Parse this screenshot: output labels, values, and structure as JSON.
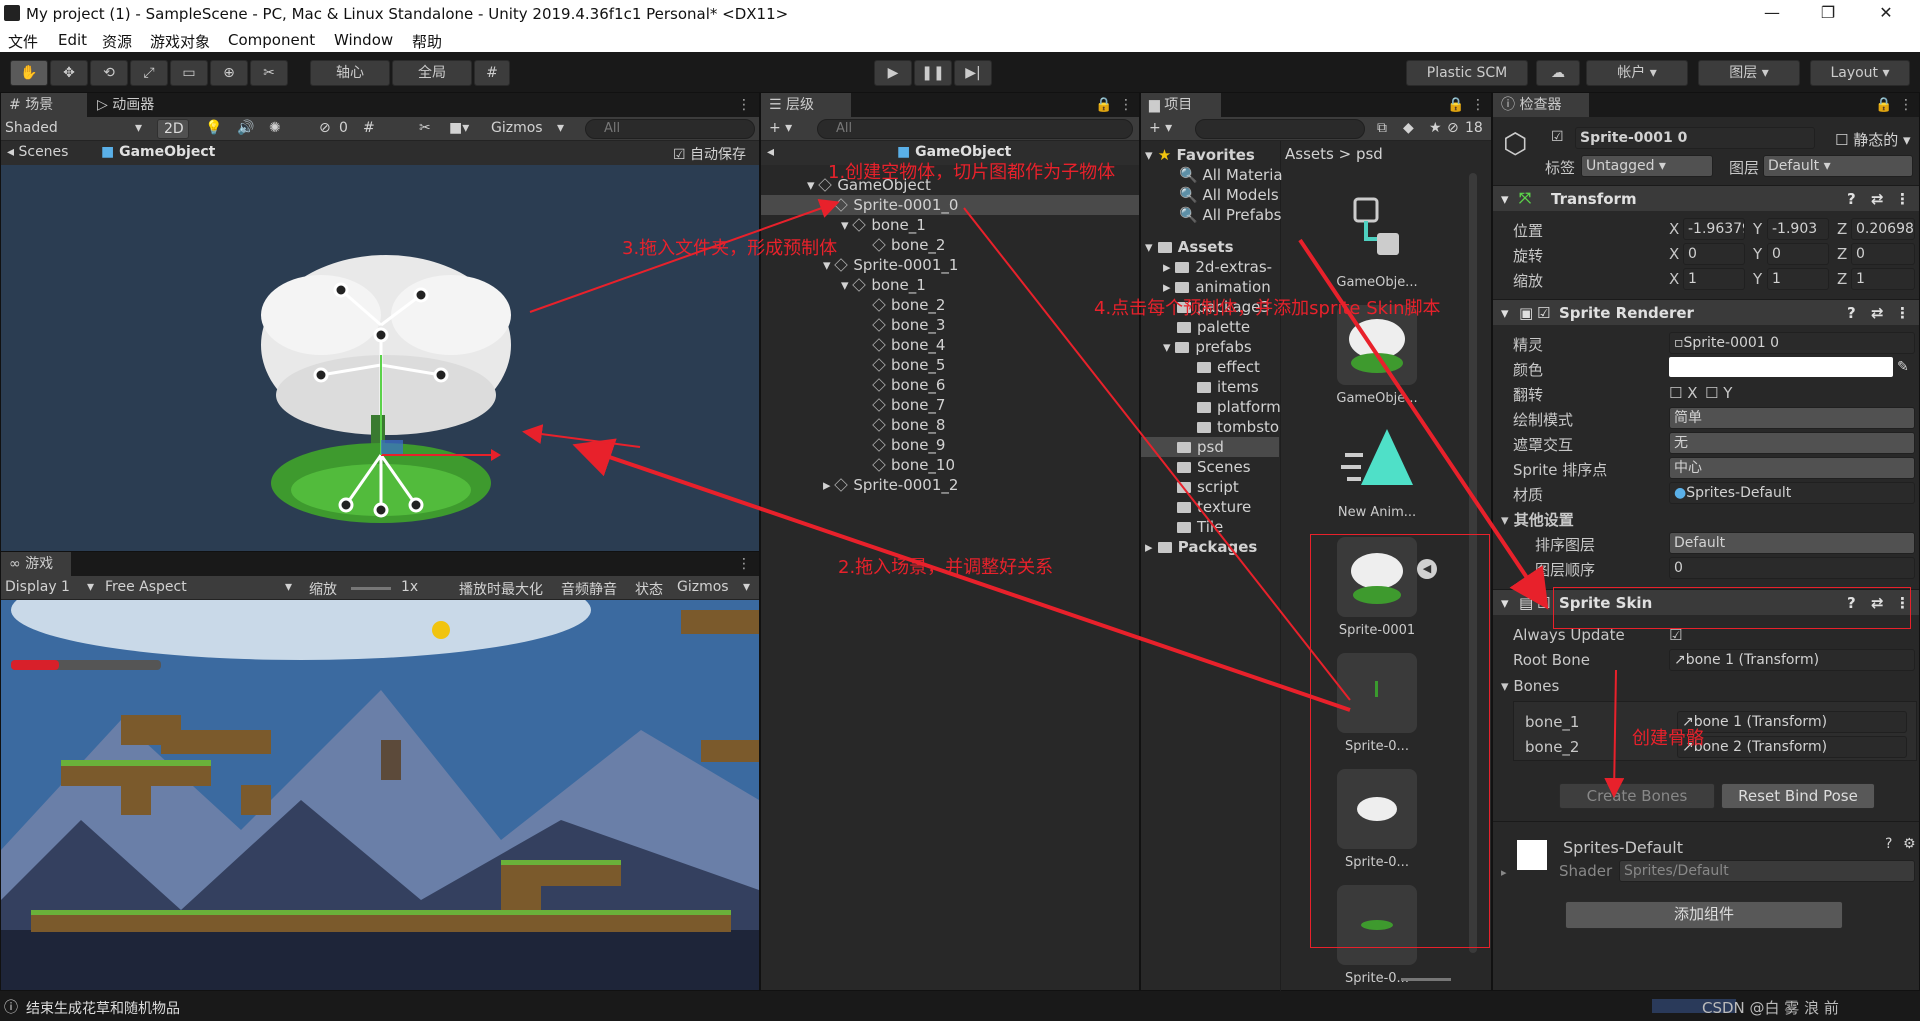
{
  "window": {
    "title": "My project (1) - SampleScene - PC, Mac & Linux Standalone - Unity 2019.4.36f1c1 Personal* <DX11>",
    "minimize": "—",
    "maximize": "❐",
    "close": "✕"
  },
  "menu": [
    "文件",
    "Edit",
    "资源",
    "游戏对象",
    "Component",
    "Window",
    "帮助"
  ],
  "toolbar": {
    "pivot": "轴心",
    "global": "全局",
    "plastic": "Plastic SCM",
    "account": "帐户",
    "layers": "图层",
    "layout": "Layout"
  },
  "scene": {
    "tab_scene": "场景",
    "tab_animator": "动画器",
    "shading": "Shaded",
    "mode2d": "2D",
    "hidden_count": "0",
    "gizmos": "Gizmos",
    "search": "All",
    "breadcrumb_scenes": "Scenes",
    "breadcrumb_obj": "GameObject",
    "autosave": "自动保存"
  },
  "game": {
    "tab": "游戏",
    "display": "Display 1",
    "aspect": "Free Aspect",
    "scale_label": "缩放",
    "scale": "1x",
    "maximize": "播放时最大化",
    "mute": "音频静音",
    "stats": "状态",
    "gizmos": "Gizmos"
  },
  "hierarchy": {
    "tab": "层级",
    "search": "All",
    "breadcrumb": "GameObject",
    "items": [
      "GameObject",
      "Sprite-0001_0",
      "bone_1",
      "bone_2",
      "Sprite-0001_1",
      "bone_1",
      "bone_2",
      "bone_3",
      "bone_4",
      "bone_5",
      "bone_6",
      "bone_7",
      "bone_8",
      "bone_9",
      "bone_10",
      "Sprite-0001_2"
    ]
  },
  "project": {
    "tab": "项目",
    "hidden_count": "18",
    "favorites": "Favorites",
    "fav_items": [
      "All Materia",
      "All Models",
      "All Prefabs"
    ],
    "assets": "Assets",
    "folders": [
      "2d-extras-",
      "animation",
      "package3",
      "palette",
      "prefabs",
      "effect",
      "items",
      "platform",
      "tombsto",
      "psd",
      "Scenes",
      "script",
      "texture",
      "Tile"
    ],
    "packages": "Packages",
    "path_root": "Assets",
    "path_sep": ">",
    "path_cur": "psd",
    "grid": [
      "GameObje...",
      "GameObje...",
      "New Anim...",
      "Sprite-0001",
      "Sprite-0...",
      "Sprite-0...",
      "Sprite-0..."
    ]
  },
  "inspector": {
    "tab": "检查器",
    "name": "Sprite-0001 0",
    "static": "静态的",
    "tag_label": "标签",
    "tag": "Untagged",
    "layer_label": "图层",
    "layer": "Default",
    "transform": {
      "title": "Transform",
      "pos_label": "位置",
      "rot_label": "旋转",
      "scale_label": "缩放",
      "pos": [
        "-1.96379",
        "-1.903",
        "0.20698"
      ],
      "rot": [
        "0",
        "0",
        "0"
      ],
      "scale": [
        "1",
        "1",
        "1"
      ],
      "axes": [
        "X",
        "Y",
        "Z"
      ]
    },
    "renderer": {
      "title": "Sprite Renderer",
      "sprite_label": "精灵",
      "sprite": "Sprite-0001 0",
      "color_label": "颜色",
      "flip_label": "翻转",
      "flip_x": "X",
      "flip_y": "Y",
      "draw_label": "绘制模式",
      "draw": "简单",
      "mask_label": "遮罩交互",
      "mask": "无",
      "sort_point_label": "Sprite 排序点",
      "sort_point": "中心",
      "material_label": "材质",
      "material": "Sprites-Default",
      "other_label": "其他设置",
      "sort_layer_label": "排序图层",
      "sort_layer": "Default",
      "order_label": "图层顺序",
      "order": "0"
    },
    "skin": {
      "title": "Sprite Skin",
      "always_update": "Always Update",
      "root_bone_label": "Root Bone",
      "root_bone": "bone 1 (Transform)",
      "bones_label": "Bones",
      "bones": [
        {
          "name": "bone_1",
          "value": "bone 1 (Transform)"
        },
        {
          "name": "bone_2",
          "value": "bone 2 (Transform)"
        }
      ],
      "create_bones": "Create Bones",
      "reset_bind": "Reset Bind Pose"
    },
    "material": {
      "name": "Sprites-Default",
      "shader_label": "Shader",
      "shader": "Sprites/Default"
    },
    "add_component": "添加组件"
  },
  "annotations": [
    "1.创建空物体，切片图都作为子物体",
    "2.拖入场景，并调整好关系",
    "3.拖入文件夹，形成预制体",
    "4.点击每个预制体，并添加sprite Skin脚本",
    "创建骨骼"
  ],
  "status": {
    "message": "结束生成花草和随机物品",
    "watermark": "CSDN @白 雾 浪 前"
  },
  "colors": {
    "accent": "#e8212b",
    "scene_bg": "#2b3d52",
    "game_sky": "#3b6aa0"
  }
}
